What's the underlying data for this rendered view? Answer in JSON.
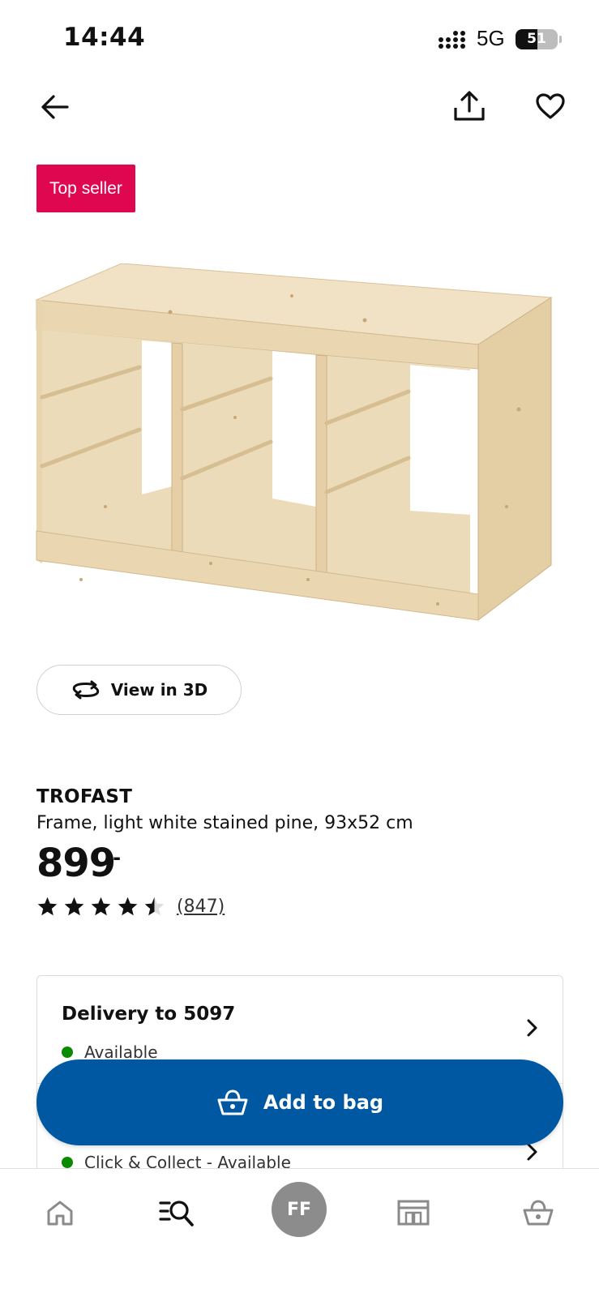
{
  "status_bar": {
    "time": "14:44",
    "network": "5G",
    "battery_percent": "51",
    "battery_level": 0.51
  },
  "header": {
    "back_icon": "arrow-left-icon",
    "share_icon": "share-icon",
    "favorite_icon": "heart-icon"
  },
  "badge": {
    "label": "Top seller",
    "color": "#e00751"
  },
  "view3d": {
    "label": "View in 3D",
    "icon": "rotate-3d-icon"
  },
  "product": {
    "name": "TROFAST",
    "description": "Frame, light white stained pine, 93x52 cm",
    "price": "899",
    "price_suffix": ",-",
    "rating": 4.5,
    "rating_max": 5,
    "review_count": "(847)"
  },
  "delivery": {
    "title": "Delivery to  5097",
    "status": "Available",
    "collect_status": "Click & Collect - Available",
    "status_color": "#0a8a00"
  },
  "add_to_bag": {
    "label": "Add to bag",
    "icon": "basket-icon",
    "color": "#0058a3"
  },
  "bottom_nav": {
    "items": [
      {
        "icon": "home-icon"
      },
      {
        "icon": "search-list-icon"
      },
      {
        "avatar": "FF"
      },
      {
        "icon": "store-icon"
      },
      {
        "icon": "basket-icon"
      }
    ]
  }
}
